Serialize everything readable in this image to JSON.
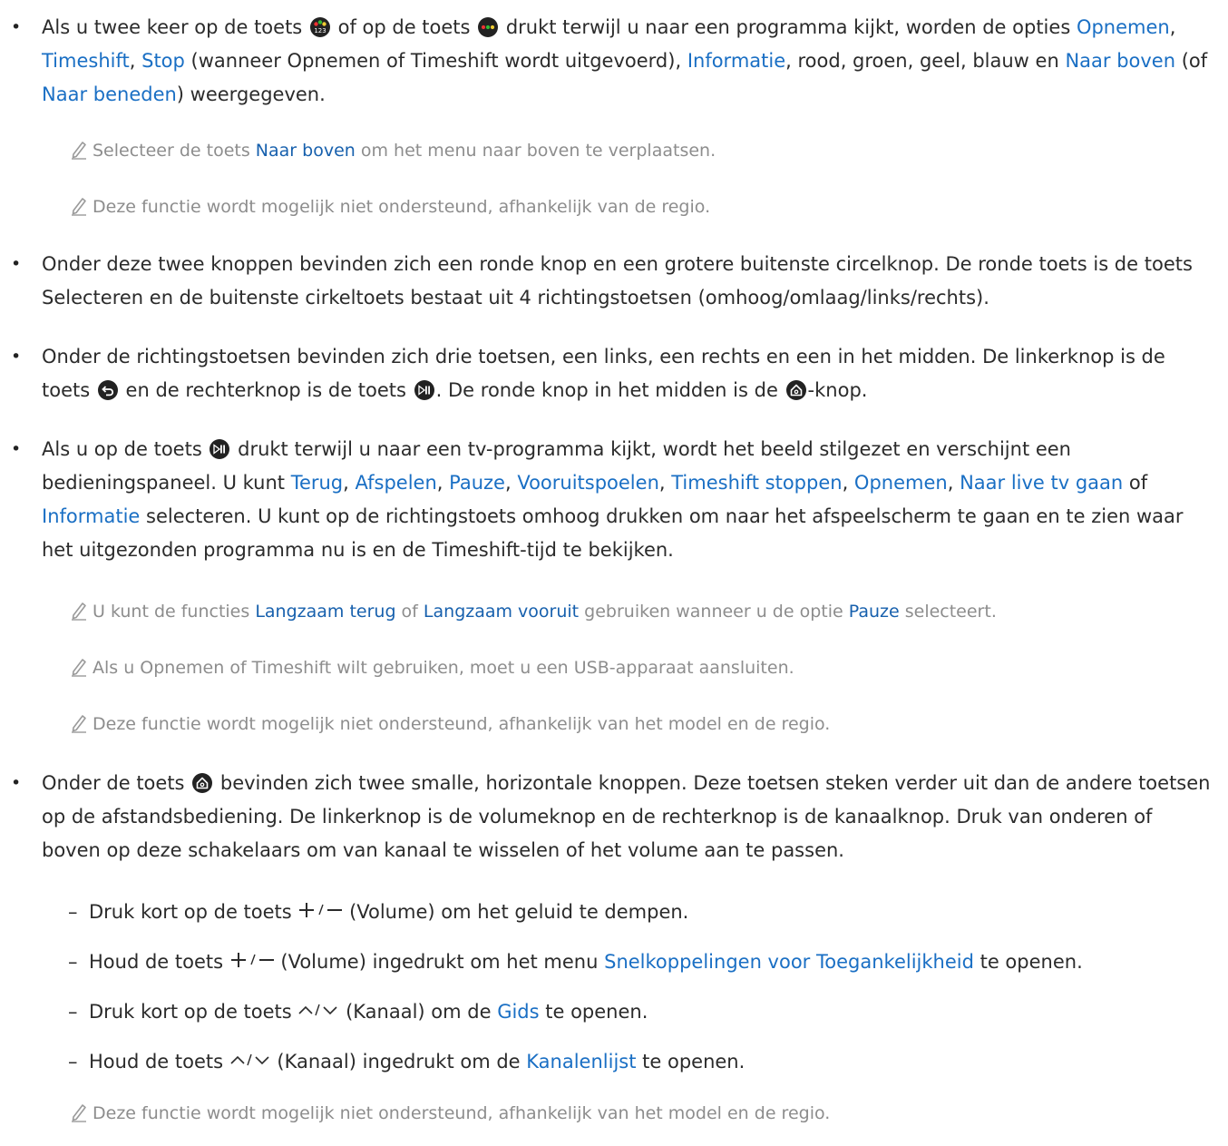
{
  "doc": {
    "bullet_glyph": "•",
    "dash_glyph": "–",
    "icons": {
      "btn_123": "color-number-button-icon",
      "btn_color": "color-button-icon",
      "btn_return": "return-button-icon",
      "btn_playpause": "play-pause-button-icon",
      "btn_home": "home-button-icon",
      "pencil": "pencil-note-icon",
      "vol": "plus-minus-volume-icon",
      "ch": "up-down-channel-icon"
    },
    "b1": {
      "t1": "Als u twee keer op de toets ",
      "t2": " of op de toets ",
      "t3": " drukt terwijl u naar een programma kijkt, worden de opties ",
      "opnemen": "Opnemen",
      "c1": ", ",
      "timeshift": "Timeshift",
      "c2": ", ",
      "stop": "Stop",
      "t4": " (wanneer Opnemen of Timeshift wordt uitgevoerd), ",
      "informatie": "Informatie",
      "t5": ", rood, groen, geel, blauw en ",
      "naar_boven": "Naar boven",
      "t6": " (of ",
      "naar_beneden": "Naar beneden",
      "t7": ") weergegeven."
    },
    "n1": {
      "t1": "Selecteer de toets ",
      "naar_boven": "Naar boven",
      "t2": " om het menu naar boven te verplaatsen."
    },
    "n2": "Deze functie wordt mogelijk niet ondersteund, afhankelijk van de regio.",
    "b2": "Onder deze twee knoppen bevinden zich een ronde knop en een grotere buitenste circelknop. De ronde toets is de toets Selecteren en de buitenste cirkeltoets bestaat uit 4 richtingstoetsen (omhoog/omlaag/links/rechts).",
    "b3": {
      "t1": "Onder de richtingstoetsen bevinden zich drie toetsen, een links, een rechts en een in het midden. De linkerknop is de toets ",
      "t2": " en de rechterknop is de toets ",
      "t3": ". De ronde knop in het midden is de ",
      "t4": "-knop."
    },
    "b4": {
      "t1": "Als u op de toets ",
      "t2": " drukt terwijl u naar een tv-programma kijkt, wordt het beeld stilgezet en verschijnt een bedieningspaneel. U kunt ",
      "terug": "Terug",
      "c1": ", ",
      "afspelen": "Afspelen",
      "c2": ", ",
      "pauze": "Pauze",
      "c3": ", ",
      "vooruitspoelen": "Vooruitspoelen",
      "c4": ", ",
      "timeshift_stoppen": "Timeshift stoppen",
      "c5": ", ",
      "opnemen": "Opnemen",
      "c6": ", ",
      "naar_live": "Naar live tv gaan",
      "t3": " of ",
      "informatie": "Informatie",
      "t4": " selecteren. U kunt op de richtingstoets omhoog drukken om naar het afspeelscherm te gaan en te zien waar het uitgezonden programma nu is en de Timeshift-tijd te bekijken."
    },
    "n3": {
      "t1": "U kunt de functies ",
      "langzaam_terug": "Langzaam terug",
      "t2": " of ",
      "langzaam_vooruit": "Langzaam vooruit",
      "t3": " gebruiken wanneer u de optie ",
      "pauze": "Pauze",
      "t4": " selecteert."
    },
    "n4": "Als u Opnemen of Timeshift wilt gebruiken, moet u een USB-apparaat aansluiten.",
    "n5": "Deze functie wordt mogelijk niet ondersteund, afhankelijk van het model en de regio.",
    "b5": {
      "t1": "Onder de toets ",
      "t2": " bevinden zich twee smalle, horizontale knoppen. Deze toetsen steken verder uit dan de andere toetsen op de afstandsbediening. De linkerknop is de volumeknop en de rechterknop is de kanaalknop. Druk van onderen of boven op deze schakelaars om van kanaal te wisselen of het volume aan te passen."
    },
    "s1": {
      "t1": "Druk kort op de toets ",
      "t2": " (Volume) om het geluid te dempen."
    },
    "s2": {
      "t1": "Houd de toets ",
      "t2": " (Volume) ingedrukt om het menu ",
      "snel": "Snelkoppelingen voor Toegankelijkheid",
      "t3": " te openen."
    },
    "s3": {
      "t1": "Druk kort op de toets ",
      "t2": " (Kanaal) om de ",
      "gids": "Gids",
      "t3": " te openen."
    },
    "s4": {
      "t1": "Houd de toets ",
      "t2": " (Kanaal) ingedrukt om de ",
      "kanalenlijst": "Kanalenlijst",
      "t3": " te openen."
    },
    "n6": "Deze functie wordt mogelijk niet ondersteund, afhankelijk van het model en de regio."
  }
}
